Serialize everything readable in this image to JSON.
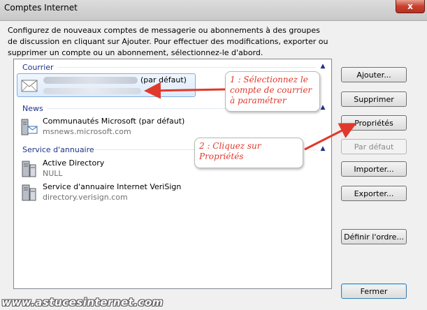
{
  "window": {
    "title": "Comptes Internet",
    "close_glyph": "x"
  },
  "description": "Configurez de nouveaux comptes de messagerie ou abonnements à des groupes de discussion en cliquant sur Ajouter. Pour effectuer des modifications, exporter ou supprimer un compte ou un abonnement, sélectionnez-le d'abord.",
  "groups": {
    "courrier": {
      "label": "Courrier",
      "items": [
        {
          "title_suffix": "(par défaut)",
          "icon": "mail-icon"
        }
      ]
    },
    "news": {
      "label": "News",
      "items": [
        {
          "title": "Communautés Microsoft (par défaut)",
          "sub": "msnews.microsoft.com",
          "icon": "news-server-icon"
        }
      ]
    },
    "annuaire": {
      "label": "Service d'annuaire",
      "items": [
        {
          "title": "Active Directory",
          "sub": "NULL",
          "icon": "directory-server-icon"
        },
        {
          "title": "Service d'annuaire Internet VeriSign",
          "sub": "directory.verisign.com",
          "icon": "directory-server-icon"
        }
      ]
    }
  },
  "buttons": {
    "ajouter": "Ajouter...",
    "supprimer": "Supprimer",
    "proprietes": "Propriétés",
    "par_defaut": "Par défaut",
    "importer": "Importer...",
    "exporter": "Exporter...",
    "definir_ordre": "Définir l'ordre...",
    "fermer": "Fermer"
  },
  "annotations": {
    "callout1": "1 : Sélectionnez le compte de courrier à paramétrer",
    "callout2": "2 : Cliquez sur Propriétés",
    "accent_color": "#e0392c"
  },
  "watermark": "www.astucesinternet.com"
}
